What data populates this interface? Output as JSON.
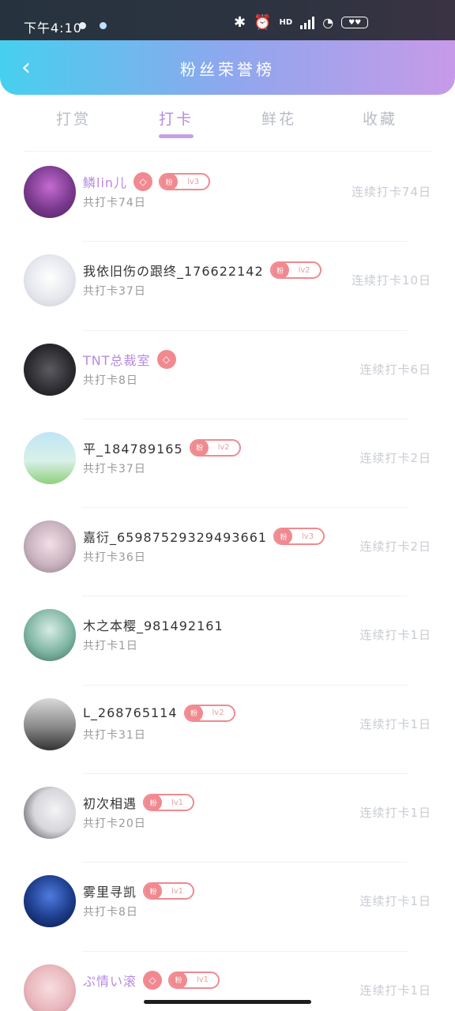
{
  "status_bar": {
    "time": "下午4:10",
    "network": "HD",
    "battery": "♥♥"
  },
  "header": {
    "back_glyph": "‹",
    "title": "粉丝荣誉榜"
  },
  "tabs": [
    {
      "label": "打赏",
      "active": false
    },
    {
      "label": "打卡",
      "active": true
    },
    {
      "label": "鲜花",
      "active": false
    },
    {
      "label": "收藏",
      "active": false
    }
  ],
  "list": [
    {
      "name": "鳞lin儿",
      "vip": true,
      "level": "lv3",
      "total": "共打卡74日",
      "streak": "连续打卡74日",
      "avatar_color": "#7a3a8e"
    },
    {
      "name": "我依旧伤の跟终_176622142",
      "vip": false,
      "level": "lv2",
      "total": "共打卡37日",
      "streak": "连续打卡10日",
      "avatar_color": "#dfe3ea"
    },
    {
      "name": "TNT总裁室",
      "vip": true,
      "level": "",
      "total": "共打卡8日",
      "streak": "连续打卡6日",
      "avatar_color": "#2b2b2f"
    },
    {
      "name": "平_184789165",
      "vip": false,
      "level": "lv2",
      "total": "共打卡37日",
      "streak": "连续打卡2日",
      "avatar_color": "#a7d89a"
    },
    {
      "name": "嘉衍_65987529329493661",
      "vip": false,
      "level": "lv3",
      "total": "共打卡36日",
      "streak": "连续打卡2日",
      "avatar_color": "#c9b3bf"
    },
    {
      "name": "木之本樱_981492161",
      "vip": false,
      "level": "",
      "total": "共打卡1日",
      "streak": "连续打卡1日",
      "avatar_color": "#7fb6a3"
    },
    {
      "name": "L_268765114",
      "vip": false,
      "level": "lv2",
      "total": "共打卡31日",
      "streak": "连续打卡1日",
      "avatar_color": "#7a7a7a"
    },
    {
      "name": "初次相遇",
      "vip": false,
      "level": "lv1",
      "total": "共打卡20日",
      "streak": "连续打卡1日",
      "avatar_color": "#d6d6db"
    },
    {
      "name": "雾里寻凯",
      "vip": false,
      "level": "lv1",
      "total": "共打卡8日",
      "streak": "连续打卡1日",
      "avatar_color": "#1d3c8a"
    },
    {
      "name": "ぷ情い滚",
      "vip": true,
      "level": "lv1",
      "total": "",
      "streak": "连续打卡1日",
      "avatar_color": "#e9b8bd"
    }
  ],
  "colors": {
    "accent": "#b98be0",
    "badge": "#f08a90"
  }
}
